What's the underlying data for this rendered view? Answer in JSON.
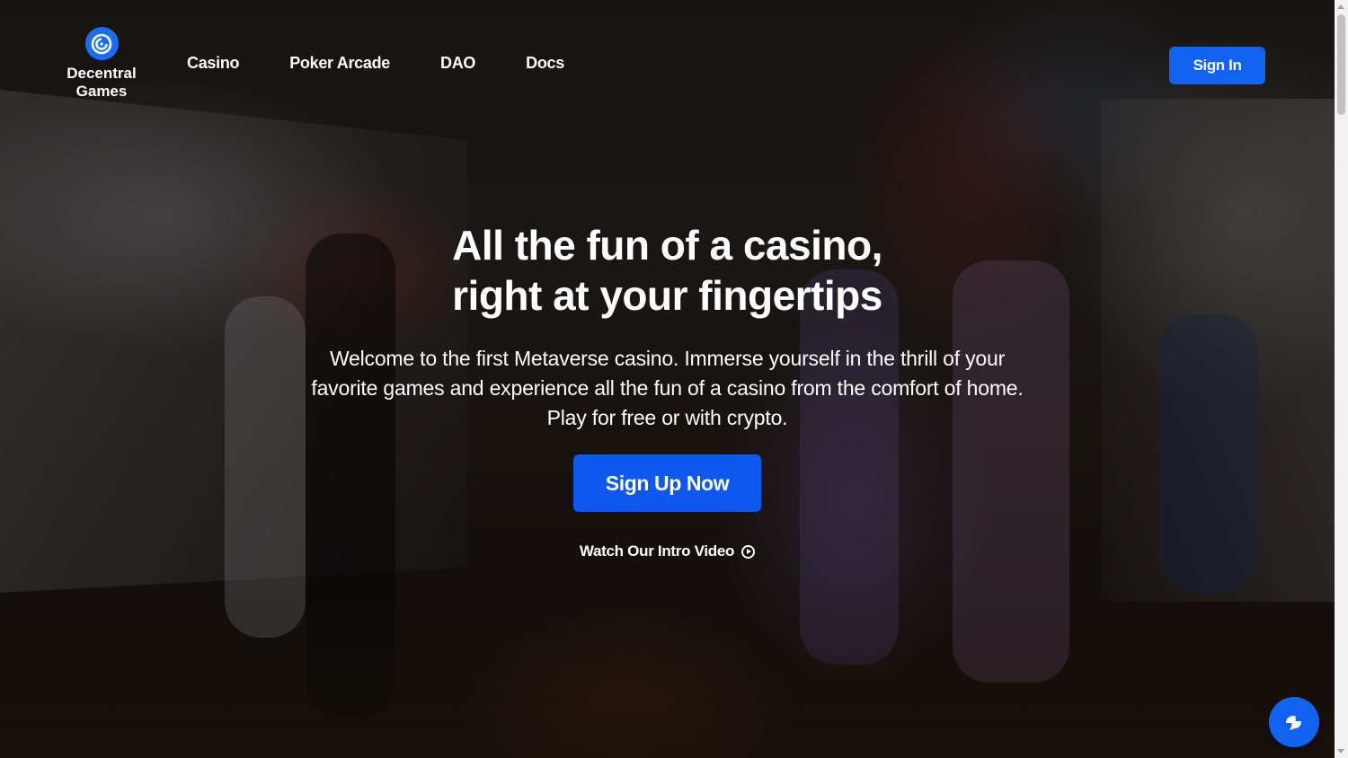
{
  "brand": {
    "name_line1": "Decentral",
    "name_line2": "Games",
    "logo_icon": "decentral-games-logo-icon",
    "accent_color": "#1263f1"
  },
  "nav": {
    "items": [
      {
        "label": "Casino"
      },
      {
        "label": "Poker Arcade"
      },
      {
        "label": "DAO"
      },
      {
        "label": "Docs"
      }
    ],
    "sign_in_label": "Sign In"
  },
  "hero": {
    "title_line1": "All the fun of a casino,",
    "title_line2": "right at your fingertips",
    "subtitle_line1": "Welcome to the first Metaverse casino. Immerse yourself in the thrill of your",
    "subtitle_line2": "favorite games and experience all the fun of a casino from the comfort of home.",
    "subtitle_line3": "Play for free or with crypto.",
    "cta_label": "Sign Up Now",
    "video_link_label": "Watch Our Intro Video",
    "video_icon": "play-circle-icon"
  },
  "chat": {
    "icon": "chat-bubble-icon"
  }
}
